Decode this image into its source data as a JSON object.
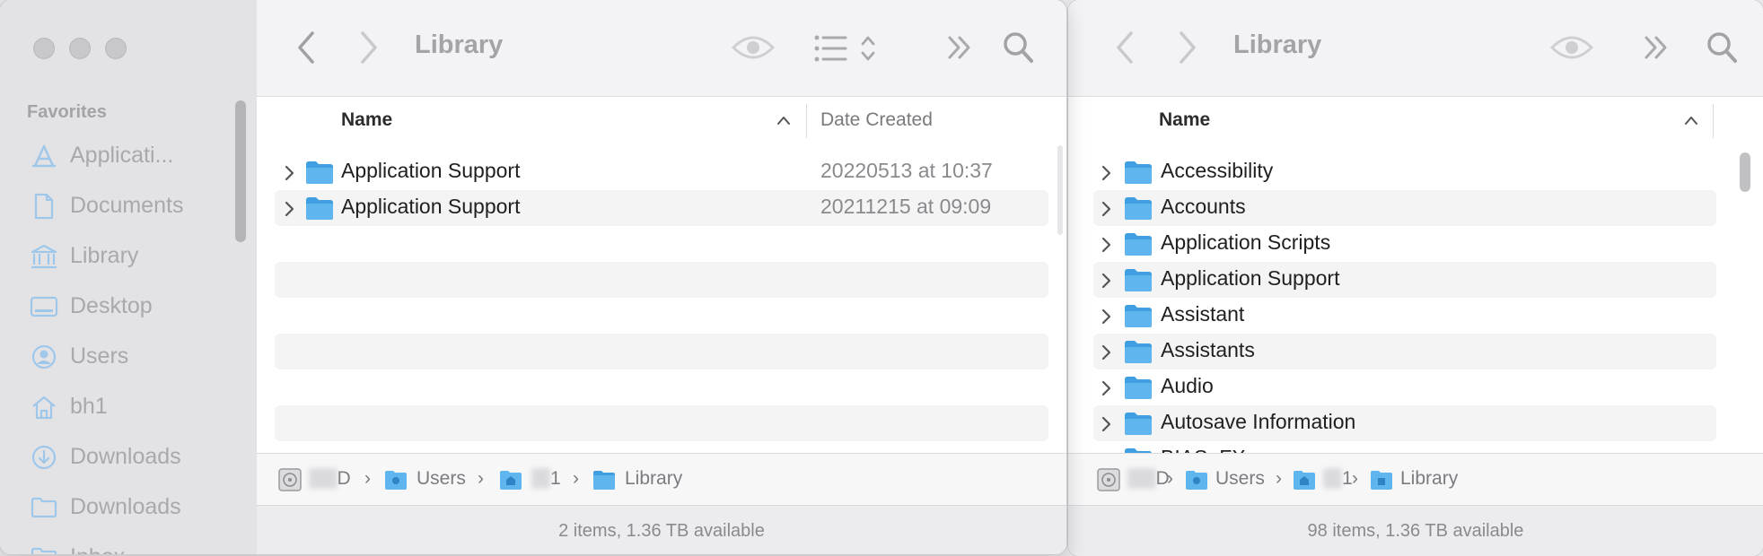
{
  "left_window": {
    "title": "Library",
    "sidebar": {
      "section": "Favorites",
      "items": [
        {
          "label": "Applicati...",
          "icon": "applications-icon"
        },
        {
          "label": "Documents",
          "icon": "document-icon"
        },
        {
          "label": "Library",
          "icon": "library-icon"
        },
        {
          "label": "Desktop",
          "icon": "desktop-icon"
        },
        {
          "label": "Users",
          "icon": "user-icon"
        },
        {
          "label": "bh1",
          "icon": "home-icon"
        },
        {
          "label": "Downloads",
          "icon": "downloads-icon"
        },
        {
          "label": "Downloads",
          "icon": "folder-icon"
        },
        {
          "label": "Inbox",
          "icon": "folder-icon"
        }
      ]
    },
    "columns": {
      "name": "Name",
      "date": "Date Created"
    },
    "rows": [
      {
        "name": "Application Support",
        "date": "20220513 at 10:37"
      },
      {
        "name": "Application Support",
        "date": "20211215 at 09:09"
      }
    ],
    "path": [
      {
        "label": "D",
        "icon": "disk-icon"
      },
      {
        "label": "Users",
        "icon": "users-folder-icon"
      },
      {
        "label": "1",
        "icon": "home-folder-icon"
      },
      {
        "label": "Library",
        "icon": "folder-icon"
      }
    ],
    "status": "2 items, 1.36 TB available"
  },
  "right_window": {
    "title": "Library",
    "columns": {
      "name": "Name"
    },
    "rows": [
      {
        "name": "Accessibility"
      },
      {
        "name": "Accounts"
      },
      {
        "name": "Application Scripts"
      },
      {
        "name": "Application Support"
      },
      {
        "name": "Assistant"
      },
      {
        "name": "Assistants"
      },
      {
        "name": "Audio"
      },
      {
        "name": "Autosave Information"
      },
      {
        "name": "BIAS_FX"
      }
    ],
    "path": [
      {
        "label": "D",
        "icon": "disk-icon"
      },
      {
        "label": "Users",
        "icon": "users-folder-icon"
      },
      {
        "label": "1",
        "icon": "home-folder-icon"
      },
      {
        "label": "Library",
        "icon": "library-folder-icon"
      }
    ],
    "status": "98 items, 1.36 TB available"
  },
  "colors": {
    "folder": "#5fb6ee",
    "folder_dark": "#3f9fe0",
    "sidebar_icon": "#9ec7ea"
  }
}
